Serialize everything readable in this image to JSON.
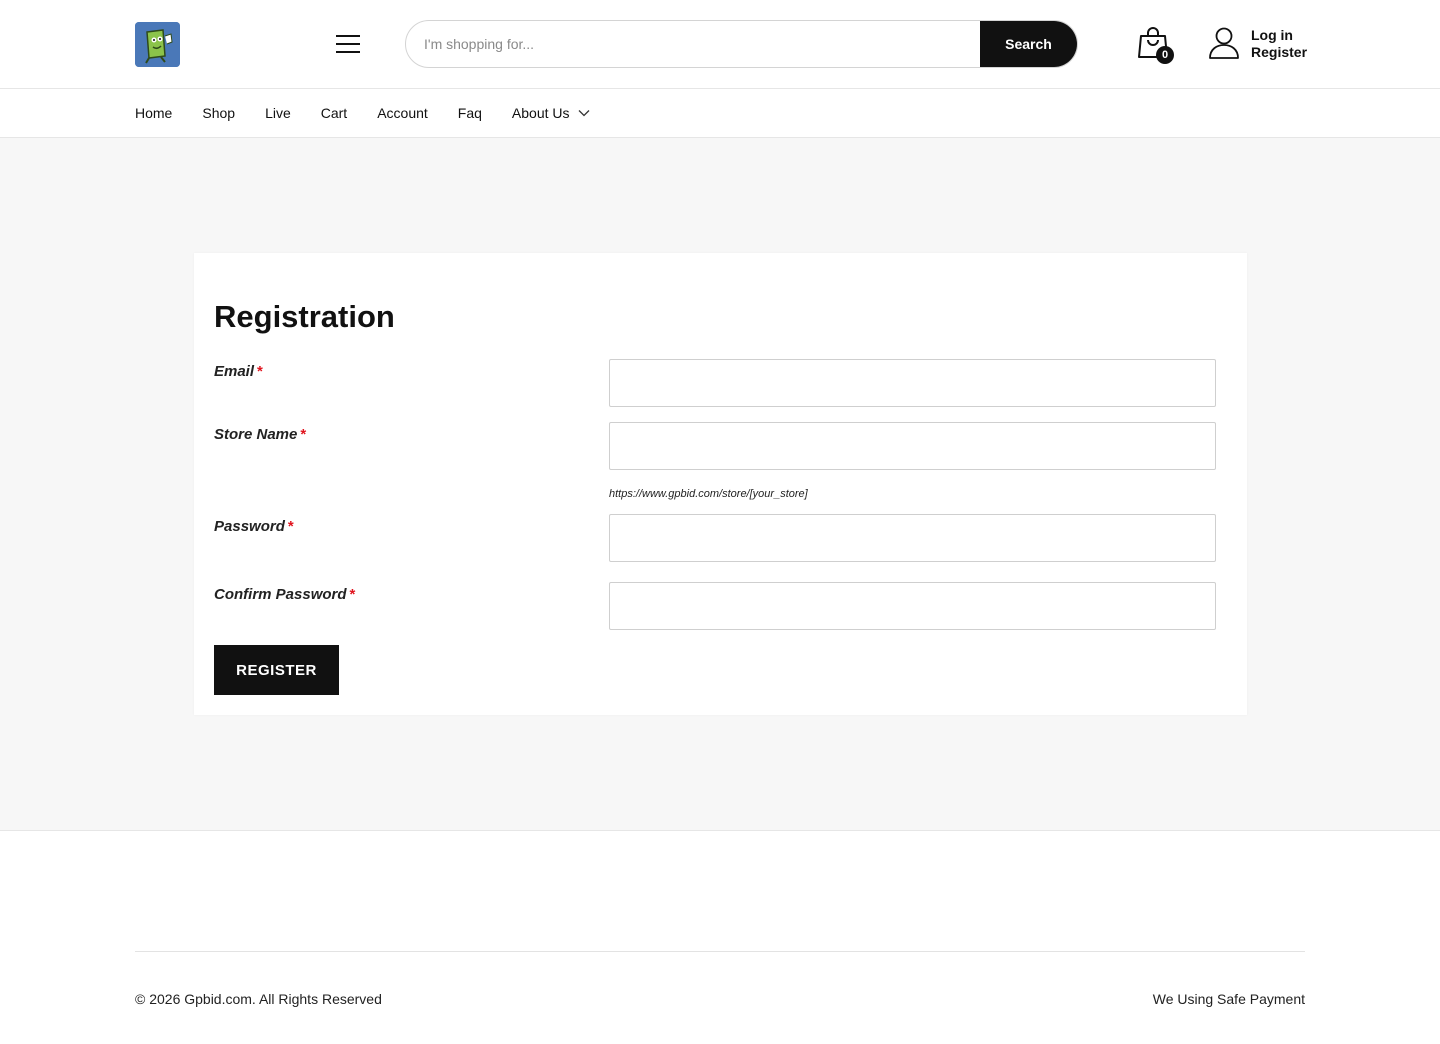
{
  "header": {
    "search": {
      "placeholder": "I'm shopping for...",
      "button_label": "Search"
    },
    "cart": {
      "count": "0"
    },
    "account": {
      "login_label": "Log in",
      "register_label": "Register"
    }
  },
  "nav": {
    "items": [
      "Home",
      "Shop",
      "Live",
      "Cart",
      "Account",
      "Faq",
      "About Us"
    ]
  },
  "form": {
    "title": "Registration",
    "email_label": "Email",
    "store_name_label": "Store Name",
    "store_url_hint": "https://www.gpbid.com/store/[your_store]",
    "password_label": "Password",
    "confirm_password_label": "Confirm Password",
    "required_mark": "*",
    "submit_label": "REGISTER"
  },
  "footer": {
    "copyright": "© 2026 Gpbid.com. All Rights Reserved",
    "payment_note": "We Using Safe Payment"
  },
  "colors": {
    "accent": "#111111",
    "required": "#e0141e",
    "logo_bg": "#4a78b8"
  }
}
